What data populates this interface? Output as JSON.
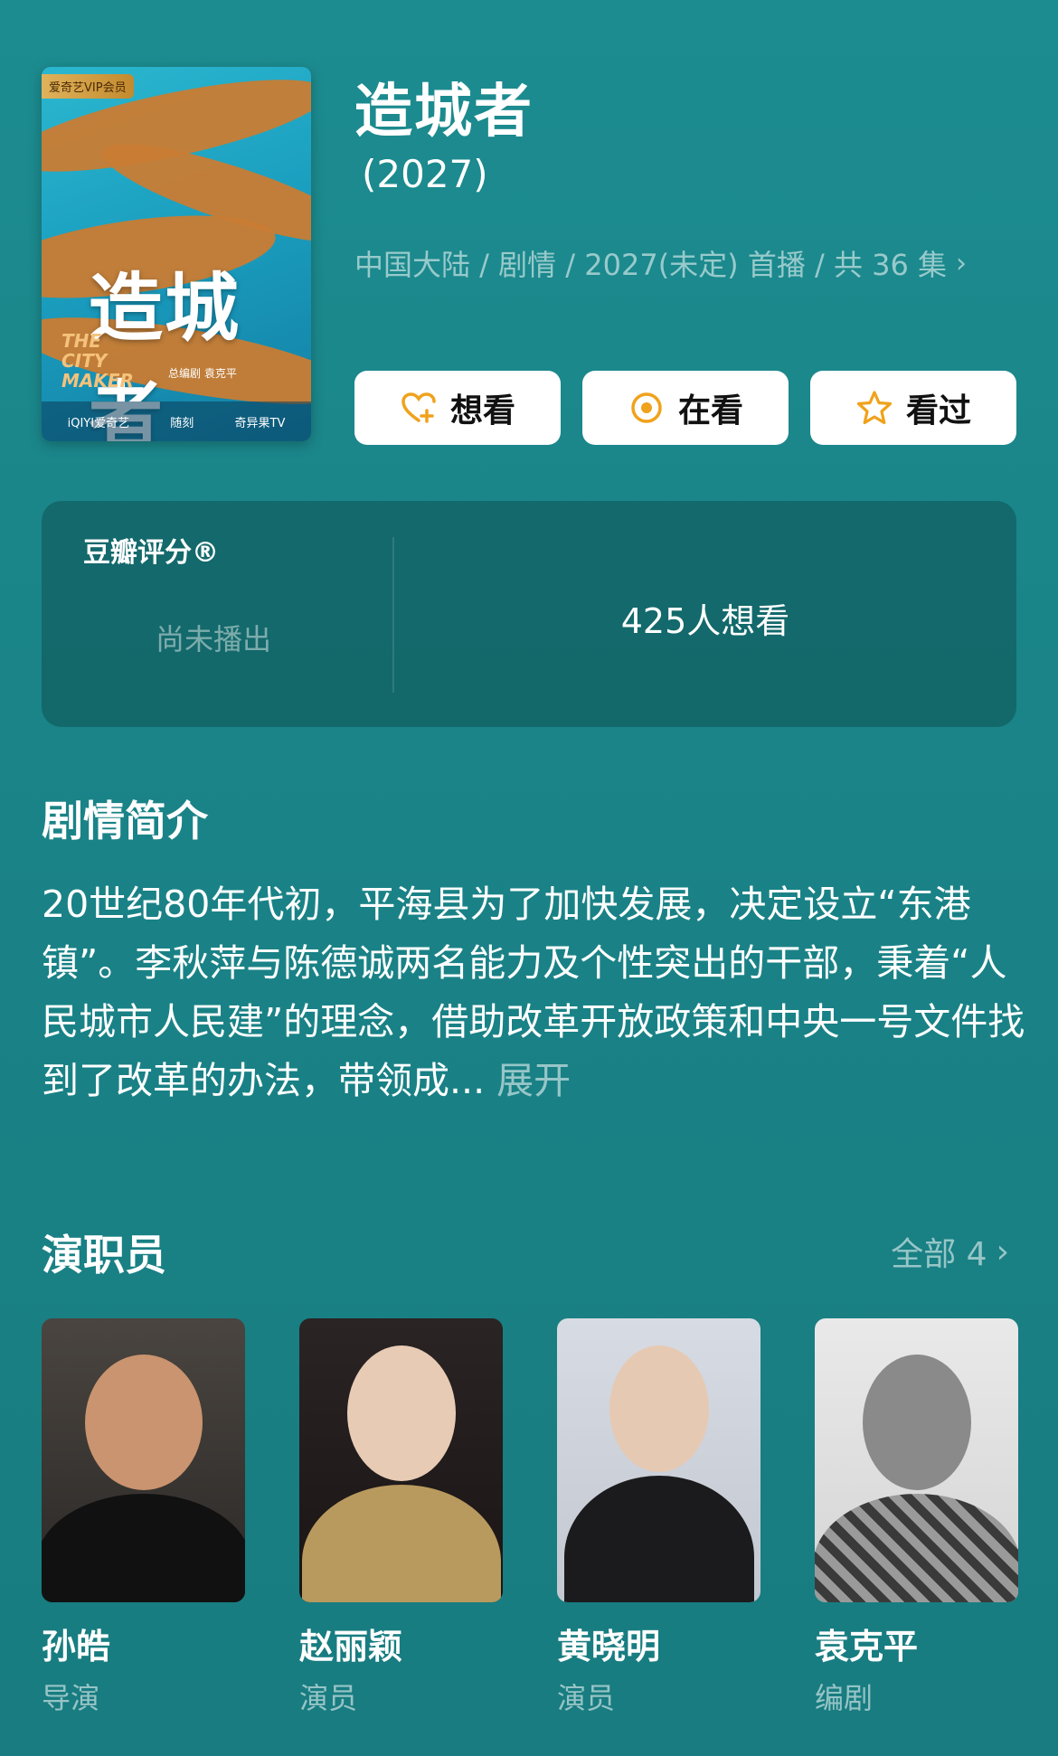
{
  "poster": {
    "badge": "爱奇艺VIP会员",
    "title": "造城者",
    "subtitle": "THE CITY MAKER",
    "credit": "总编剧  袁克平",
    "footer": [
      "iQIYI爱奇艺",
      "随刻",
      "奇异果TV"
    ]
  },
  "show": {
    "title": "造城者",
    "year": "(2027)",
    "meta": "中国大陆 / 剧情 / 2027(未定) 首播 / 共 36 集",
    "meta_chevron": "›"
  },
  "actions": [
    {
      "label": "想看",
      "icon": "heart-plus-icon"
    },
    {
      "label": "在看",
      "icon": "target-icon"
    },
    {
      "label": "看过",
      "icon": "star-icon"
    }
  ],
  "colors": {
    "accent": "#f0a21c",
    "background": "#1c8c90"
  },
  "rating": {
    "label": "豆瓣评分®",
    "status": "尚未播出",
    "want_count": "425人想看"
  },
  "synopsis": {
    "title": "剧情简介",
    "text": "20世纪80年代初，平海县为了加快发展，决定设立“东港镇”。李秋萍与陈德诚两名能力及个性突出的干部，秉着“人民城市人民建”的理念，借助改革开放政策和中央一号文件找到了改革的办法，带领成...",
    "expand": "展开"
  },
  "cast": {
    "title": "演职员",
    "all_label": "全部 4",
    "chevron": "›",
    "members": [
      {
        "name": "孙皓",
        "role": "导演"
      },
      {
        "name": "赵丽颖",
        "role": "演员"
      },
      {
        "name": "黄晓明",
        "role": "演员"
      },
      {
        "name": "袁克平",
        "role": "编剧"
      }
    ]
  }
}
